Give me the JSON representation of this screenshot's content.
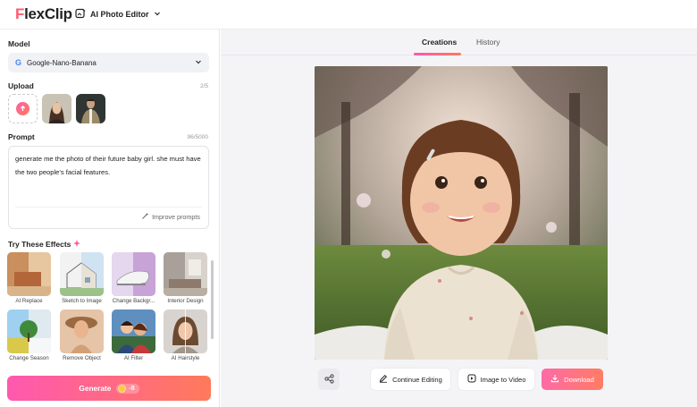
{
  "app": {
    "logo_text_a": "F",
    "logo_text_b": "lexClip",
    "editor_label": "AI Photo Editor"
  },
  "left_panel": {
    "model": {
      "title": "Model",
      "value": "Google-Nano-Banana"
    },
    "upload": {
      "title": "Upload",
      "count": "2/5"
    },
    "prompt": {
      "title": "Prompt",
      "count": "96/5000",
      "text": "generate me the photo of their future baby girl. she must have the two people's facial features.",
      "improve_label": "Improve prompts"
    },
    "effects": {
      "title": "Try These Effects",
      "items": [
        {
          "label": "AI Replace"
        },
        {
          "label": "Sketch to Image"
        },
        {
          "label": "Change Backgr..."
        },
        {
          "label": "Interior Design"
        },
        {
          "label": "Change Season"
        },
        {
          "label": "Remove Object"
        },
        {
          "label": "AI Filter"
        },
        {
          "label": "AI Hairstyle"
        }
      ]
    },
    "generate": {
      "label": "Generate",
      "credits": "-8"
    }
  },
  "main": {
    "tabs": [
      {
        "label": "Creations",
        "active": true
      },
      {
        "label": "History",
        "active": false
      }
    ],
    "actions": {
      "continue_label": "Continue Editing",
      "video_label": "Image to Video",
      "download_label": "Download"
    }
  },
  "colors": {
    "accent_start": "#ff58b0",
    "accent_end": "#ff7a5a",
    "logo_accent": "#ff5a6e"
  },
  "icons": [
    "upload-icon",
    "share-icon",
    "edit-icon",
    "video-icon",
    "download-icon",
    "sparkle-icon",
    "chevron-down-icon",
    "google-icon",
    "photo-editor-icon"
  ]
}
